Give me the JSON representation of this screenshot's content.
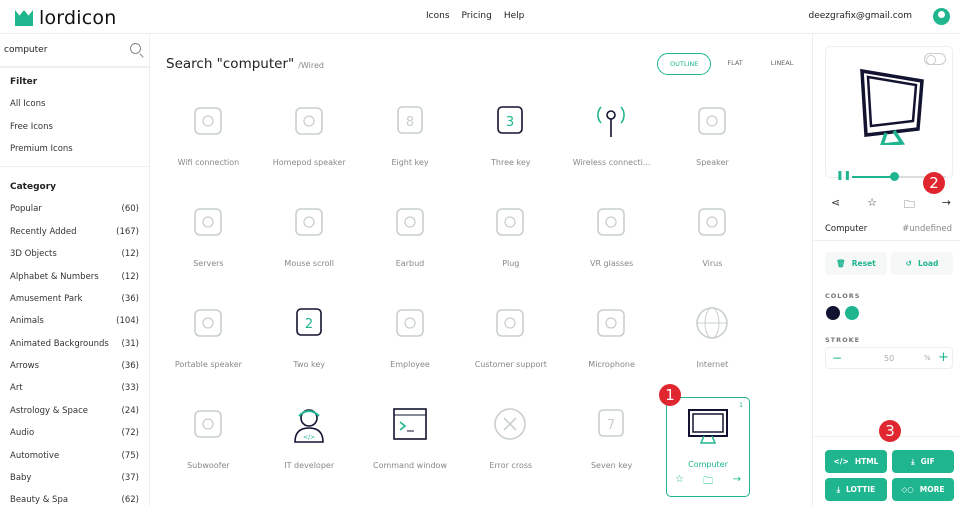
{
  "header": {
    "logo": "lordicon",
    "nav": [
      "Icons",
      "Pricing",
      "Help"
    ],
    "user_email": "deezgrafix@gmail.com"
  },
  "sidebar": {
    "search_value": "computer",
    "filter_title": "Filter",
    "filters": [
      "All Icons",
      "Free Icons",
      "Premium Icons"
    ],
    "category_title": "Category",
    "categories": [
      {
        "name": "Popular",
        "count": "(60)"
      },
      {
        "name": "Recently Added",
        "count": "(167)"
      },
      {
        "name": "3D Objects",
        "count": "(12)"
      },
      {
        "name": "Alphabet & Numbers",
        "count": "(12)"
      },
      {
        "name": "Amusement Park",
        "count": "(36)"
      },
      {
        "name": "Animals",
        "count": "(104)"
      },
      {
        "name": "Animated Backgrounds",
        "count": "(31)"
      },
      {
        "name": "Arrows",
        "count": "(36)"
      },
      {
        "name": "Art",
        "count": "(33)"
      },
      {
        "name": "Astrology & Space",
        "count": "(24)"
      },
      {
        "name": "Audio",
        "count": "(72)"
      },
      {
        "name": "Automotive",
        "count": "(75)"
      },
      {
        "name": "Baby",
        "count": "(37)"
      },
      {
        "name": "Beauty & Spa",
        "count": "(62)"
      }
    ]
  },
  "main": {
    "title": "Search \"computer\"",
    "subtitle": "/Wired",
    "styles": [
      "OUTLINE",
      "FLAT",
      "LINEAL"
    ],
    "icons": [
      {
        "label": "Wifi connection",
        "icon": "router-icon"
      },
      {
        "label": "Homepod speaker",
        "icon": "homepod-icon"
      },
      {
        "label": "Eight key",
        "icon": "key-icon",
        "glyph": "8"
      },
      {
        "label": "Three key",
        "icon": "key-icon",
        "glyph": "3",
        "dark": true
      },
      {
        "label": "Wireless connecti...",
        "icon": "antenna-icon",
        "dark": true
      },
      {
        "label": "Speaker",
        "icon": "speaker-icon"
      },
      {
        "label": "Servers",
        "icon": "server-icon"
      },
      {
        "label": "Mouse scroll",
        "icon": "mouse-icon"
      },
      {
        "label": "Earbud",
        "icon": "earbud-icon"
      },
      {
        "label": "Plug",
        "icon": "plug-icon"
      },
      {
        "label": "VR glasses",
        "icon": "vr-icon"
      },
      {
        "label": "Virus",
        "icon": "virus-icon"
      },
      {
        "label": "Portable speaker",
        "icon": "portable-speaker-icon"
      },
      {
        "label": "Two key",
        "icon": "key-icon",
        "glyph": "2",
        "dark": true
      },
      {
        "label": "Employee",
        "icon": "employee-icon"
      },
      {
        "label": "Customer support",
        "icon": "headset-icon"
      },
      {
        "label": "Microphone",
        "icon": "microphone-icon"
      },
      {
        "label": "Internet",
        "icon": "globe-icon"
      },
      {
        "label": "Subwoofer",
        "icon": "subwoofer-icon"
      },
      {
        "label": "IT developer",
        "icon": "developer-icon",
        "dark": true
      },
      {
        "label": "Command window",
        "icon": "terminal-icon",
        "dark": true
      },
      {
        "label": "Error cross",
        "icon": "error-cross-icon"
      },
      {
        "label": "Seven key",
        "icon": "key-icon",
        "glyph": "7"
      },
      {
        "label": "Computer",
        "icon": "computer-icon",
        "dark": true,
        "selected": true,
        "count": "1"
      }
    ]
  },
  "badges": [
    "1",
    "2",
    "3"
  ],
  "panel": {
    "icon_name": "Computer",
    "tag": "#undefined",
    "reset": "Reset",
    "load": "Load",
    "colors_label": "COLORS",
    "colors": [
      "#121331",
      "#1fb58f"
    ],
    "stroke_label": "STROKE",
    "stroke_value": "50",
    "stroke_unit": "%",
    "progress": 0.45,
    "buttons": [
      "HTML",
      "GIF",
      "LOTTIE",
      "MORE"
    ]
  },
  "accent": "#1fb58f"
}
